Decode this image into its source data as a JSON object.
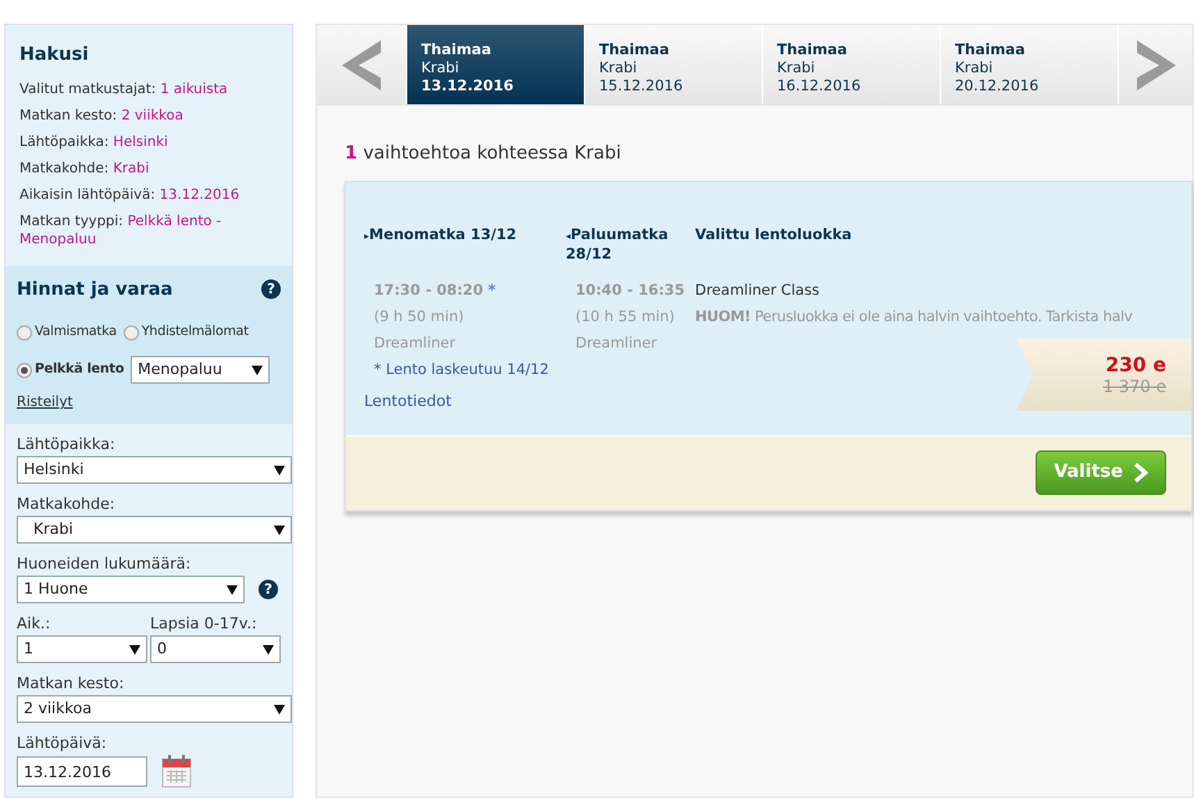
{
  "summary": {
    "title": "Hakusi",
    "items": [
      {
        "label": "Valitut matkustajat:",
        "value": "1 aikuista"
      },
      {
        "label": "Matkan kesto:",
        "value": "2 viikkoa"
      },
      {
        "label": "Lähtöpaikka:",
        "value": "Helsinki"
      },
      {
        "label": "Matkakohde:",
        "value": "Krabi"
      },
      {
        "label": "Aikaisin lähtöpäivä:",
        "value": "13.12.2016"
      },
      {
        "label": "Matkan tyyppi:",
        "value": "Pelkkä lento - Menopaluu"
      }
    ]
  },
  "prices": {
    "title": "Hinnat ja varaa",
    "help": "?",
    "trip_types": [
      {
        "label": "Valmismatka",
        "selected": false
      },
      {
        "label": "Yhdistelmälomat",
        "selected": false
      },
      {
        "label": "Pelkkä lento",
        "selected": true
      }
    ],
    "flight_type": "Menopaluu",
    "cruise_link": "Risteilyt"
  },
  "form": {
    "departure": {
      "label": "Lähtöpaikka:",
      "value": "Helsinki"
    },
    "destination": {
      "label": "Matkakohde:",
      "value": "Krabi"
    },
    "rooms": {
      "label": "Huoneiden lukumäärä:",
      "value": "1 Huone",
      "help": "?"
    },
    "adults": {
      "label": "Aik.:",
      "value": "1"
    },
    "children": {
      "label": "Lapsia 0-17v.:",
      "value": "0"
    },
    "duration": {
      "label": "Matkan kesto:",
      "value": "2 viikkoa"
    },
    "date": {
      "label": "Lähtöpäivä:",
      "value": "13.12.2016"
    }
  },
  "date_tabs": [
    {
      "country": "Thaimaa",
      "city": "Krabi",
      "date": "13.12.2016",
      "selected": true
    },
    {
      "country": "Thaimaa",
      "city": "Krabi",
      "date": "15.12.2016",
      "selected": false
    },
    {
      "country": "Thaimaa",
      "city": "Krabi",
      "date": "16.12.2016",
      "selected": false
    },
    {
      "country": "Thaimaa",
      "city": "Krabi",
      "date": "20.12.2016",
      "selected": false
    }
  ],
  "results_heading": {
    "count": "1",
    "text": "vaihtoehtoa kohteessa Krabi"
  },
  "result": {
    "outbound": {
      "marker": "▸",
      "title": "Menomatka 13/12",
      "time": "17:30 - 08:20",
      "time_note": "*",
      "duration": "(9 h 50 min)",
      "aircraft": "Dreamliner",
      "note": "* Lento laskeutuu 14/12"
    },
    "return": {
      "marker": "◂",
      "title": "Paluumatka 28/12",
      "time": "10:40 - 16:35",
      "duration": "(10 h 55 min)",
      "aircraft": "Dreamliner"
    },
    "class": {
      "title": "Valittu lentoluokka",
      "name": "Dreamliner Class",
      "notice": "**HUOM!** Perusluokka ei ole aina halvin vaihtoehto. Tarkista halv"
    },
    "details_link": "Lentotiedot",
    "price": "230 e",
    "old_price": "1 370 e",
    "select_button": "Valitse"
  }
}
